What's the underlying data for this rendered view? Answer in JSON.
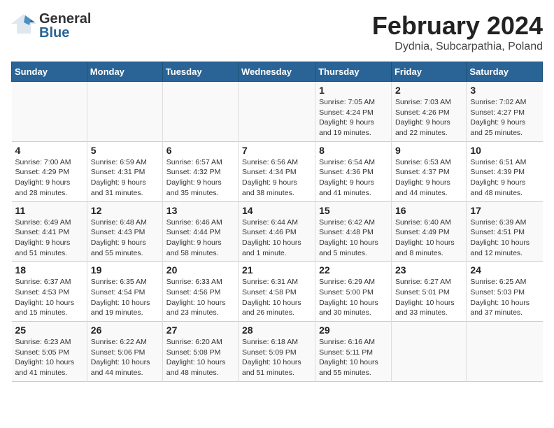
{
  "header": {
    "logo_general": "General",
    "logo_blue": "Blue",
    "title": "February 2024",
    "subtitle": "Dydnia, Subcarpathia, Poland"
  },
  "days_of_week": [
    "Sunday",
    "Monday",
    "Tuesday",
    "Wednesday",
    "Thursday",
    "Friday",
    "Saturday"
  ],
  "weeks": [
    [
      {
        "day": "",
        "info": ""
      },
      {
        "day": "",
        "info": ""
      },
      {
        "day": "",
        "info": ""
      },
      {
        "day": "",
        "info": ""
      },
      {
        "day": "1",
        "info": "Sunrise: 7:05 AM\nSunset: 4:24 PM\nDaylight: 9 hours and 19 minutes."
      },
      {
        "day": "2",
        "info": "Sunrise: 7:03 AM\nSunset: 4:26 PM\nDaylight: 9 hours and 22 minutes."
      },
      {
        "day": "3",
        "info": "Sunrise: 7:02 AM\nSunset: 4:27 PM\nDaylight: 9 hours and 25 minutes."
      }
    ],
    [
      {
        "day": "4",
        "info": "Sunrise: 7:00 AM\nSunset: 4:29 PM\nDaylight: 9 hours and 28 minutes."
      },
      {
        "day": "5",
        "info": "Sunrise: 6:59 AM\nSunset: 4:31 PM\nDaylight: 9 hours and 31 minutes."
      },
      {
        "day": "6",
        "info": "Sunrise: 6:57 AM\nSunset: 4:32 PM\nDaylight: 9 hours and 35 minutes."
      },
      {
        "day": "7",
        "info": "Sunrise: 6:56 AM\nSunset: 4:34 PM\nDaylight: 9 hours and 38 minutes."
      },
      {
        "day": "8",
        "info": "Sunrise: 6:54 AM\nSunset: 4:36 PM\nDaylight: 9 hours and 41 minutes."
      },
      {
        "day": "9",
        "info": "Sunrise: 6:53 AM\nSunset: 4:37 PM\nDaylight: 9 hours and 44 minutes."
      },
      {
        "day": "10",
        "info": "Sunrise: 6:51 AM\nSunset: 4:39 PM\nDaylight: 9 hours and 48 minutes."
      }
    ],
    [
      {
        "day": "11",
        "info": "Sunrise: 6:49 AM\nSunset: 4:41 PM\nDaylight: 9 hours and 51 minutes."
      },
      {
        "day": "12",
        "info": "Sunrise: 6:48 AM\nSunset: 4:43 PM\nDaylight: 9 hours and 55 minutes."
      },
      {
        "day": "13",
        "info": "Sunrise: 6:46 AM\nSunset: 4:44 PM\nDaylight: 9 hours and 58 minutes."
      },
      {
        "day": "14",
        "info": "Sunrise: 6:44 AM\nSunset: 4:46 PM\nDaylight: 10 hours and 1 minute."
      },
      {
        "day": "15",
        "info": "Sunrise: 6:42 AM\nSunset: 4:48 PM\nDaylight: 10 hours and 5 minutes."
      },
      {
        "day": "16",
        "info": "Sunrise: 6:40 AM\nSunset: 4:49 PM\nDaylight: 10 hours and 8 minutes."
      },
      {
        "day": "17",
        "info": "Sunrise: 6:39 AM\nSunset: 4:51 PM\nDaylight: 10 hours and 12 minutes."
      }
    ],
    [
      {
        "day": "18",
        "info": "Sunrise: 6:37 AM\nSunset: 4:53 PM\nDaylight: 10 hours and 15 minutes."
      },
      {
        "day": "19",
        "info": "Sunrise: 6:35 AM\nSunset: 4:54 PM\nDaylight: 10 hours and 19 minutes."
      },
      {
        "day": "20",
        "info": "Sunrise: 6:33 AM\nSunset: 4:56 PM\nDaylight: 10 hours and 23 minutes."
      },
      {
        "day": "21",
        "info": "Sunrise: 6:31 AM\nSunset: 4:58 PM\nDaylight: 10 hours and 26 minutes."
      },
      {
        "day": "22",
        "info": "Sunrise: 6:29 AM\nSunset: 5:00 PM\nDaylight: 10 hours and 30 minutes."
      },
      {
        "day": "23",
        "info": "Sunrise: 6:27 AM\nSunset: 5:01 PM\nDaylight: 10 hours and 33 minutes."
      },
      {
        "day": "24",
        "info": "Sunrise: 6:25 AM\nSunset: 5:03 PM\nDaylight: 10 hours and 37 minutes."
      }
    ],
    [
      {
        "day": "25",
        "info": "Sunrise: 6:23 AM\nSunset: 5:05 PM\nDaylight: 10 hours and 41 minutes."
      },
      {
        "day": "26",
        "info": "Sunrise: 6:22 AM\nSunset: 5:06 PM\nDaylight: 10 hours and 44 minutes."
      },
      {
        "day": "27",
        "info": "Sunrise: 6:20 AM\nSunset: 5:08 PM\nDaylight: 10 hours and 48 minutes."
      },
      {
        "day": "28",
        "info": "Sunrise: 6:18 AM\nSunset: 5:09 PM\nDaylight: 10 hours and 51 minutes."
      },
      {
        "day": "29",
        "info": "Sunrise: 6:16 AM\nSunset: 5:11 PM\nDaylight: 10 hours and 55 minutes."
      },
      {
        "day": "",
        "info": ""
      },
      {
        "day": "",
        "info": ""
      }
    ]
  ]
}
